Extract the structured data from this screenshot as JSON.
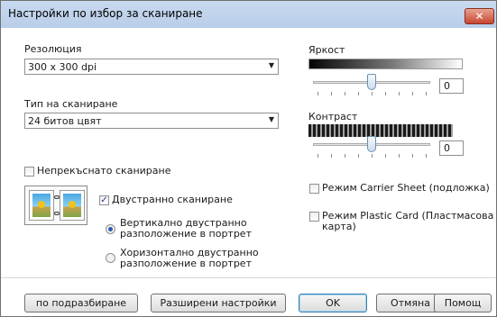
{
  "window": {
    "title": "Настройки по избор за сканиране",
    "close_label": "✕"
  },
  "resolution": {
    "label": "Резолюция",
    "value": "300 x 300 dpi"
  },
  "scan_type": {
    "label": "Тип на сканиране",
    "value": "24 битов цвят"
  },
  "brightness": {
    "label": "Яркост",
    "value": "0",
    "level": 0.5
  },
  "contrast": {
    "label": "Контраст",
    "value": "0",
    "level": 0.5
  },
  "continuous_scan": {
    "label": "Непрекъснато сканиране",
    "checked": false
  },
  "duplex": {
    "label": "Двустранно сканиране",
    "checked": true,
    "options": [
      {
        "line1": "Вертикално двустранно",
        "line2": "разположение в портрет",
        "selected": true
      },
      {
        "line1": "Хоризонтално двустранно",
        "line2": "разположение в портрет",
        "selected": false
      }
    ]
  },
  "carrier_sheet": {
    "label": "Режим Carrier Sheet (подложка)",
    "checked": false
  },
  "plastic_card": {
    "line1": "Режим Plastic Card (Пластмасова",
    "line2": "карта)",
    "checked": false
  },
  "buttons": {
    "default": "по подразбиране",
    "advanced": "Разширени настройки",
    "ok": "OK",
    "cancel": "Отмяна",
    "help": "Помощ"
  }
}
